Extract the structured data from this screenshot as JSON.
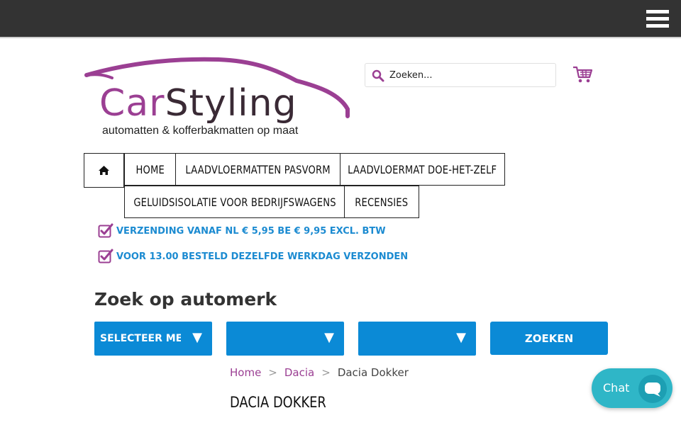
{
  "brand": {
    "name_part1": "Car",
    "name_part2": "Styling",
    "tagline": "automatten & kofferbakmatten op maat"
  },
  "colors": {
    "topbar": "#333333",
    "brand_purple": "#9b3f93",
    "accent_blue": "#0b8ad6",
    "usp_blue": "#1c8bd1",
    "chat_teal": "#2fb6c7"
  },
  "header": {
    "menu_icon": "hamburger-menu-icon",
    "search_placeholder": "Zoeken...",
    "search_icon": "search-icon",
    "cart_icon": "shopping-cart-icon"
  },
  "nav": {
    "home_icon": "home-icon",
    "items": [
      {
        "label": "HOME"
      },
      {
        "label": "LAADVLOERMATTEN PASVORM"
      },
      {
        "label": "LAADVLOERMAT DOE-HET-ZELF"
      },
      {
        "label": "GELUIDSISOLATIE VOOR BEDRIJFSWAGENS"
      },
      {
        "label": "RECENSIES"
      }
    ]
  },
  "usps": [
    {
      "icon": "checkmark-icon",
      "text": "VERZENDING VANAF NL € 5,95 BE € 9,95 EXCL. BTW"
    },
    {
      "icon": "checkmark-icon",
      "text": "VOOR 13.00 BESTELD DEZELFDE WERKDAG VERZONDEN"
    }
  ],
  "finder": {
    "title": "Zoek op automerk",
    "selects": [
      {
        "value": "SELECTEER MERK"
      },
      {
        "value": ""
      },
      {
        "value": ""
      }
    ],
    "arrow": "▼",
    "button_label": "ZOEKEN"
  },
  "breadcrumb": {
    "items": [
      "Home",
      "Dacia",
      "Dacia Dokker"
    ],
    "separator": ">"
  },
  "page_title": "DACIA DOKKER",
  "chat": {
    "label": "Chat",
    "icon": "chat-bubble-icon"
  }
}
